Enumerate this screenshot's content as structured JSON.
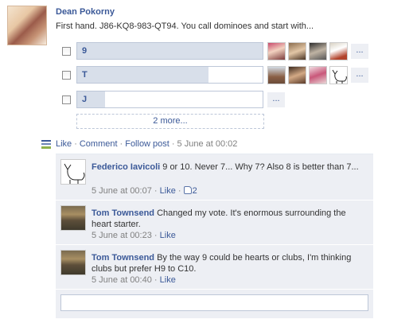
{
  "post": {
    "author": "Dean Pokorny",
    "text": "First hand. J86-KQ8-983-QT94. You call dominoes and start with..."
  },
  "poll": {
    "options": [
      {
        "label": "9",
        "fraction": 1.0,
        "more": "..."
      },
      {
        "label": "T",
        "fraction": 0.71,
        "more": "..."
      },
      {
        "label": "J",
        "fraction": 0.15,
        "more": "..."
      }
    ],
    "more_options": "2 more..."
  },
  "actions": {
    "like": "Like",
    "comment": "Comment",
    "follow": "Follow post",
    "time": "5 June at 00:02"
  },
  "comments": [
    {
      "author": "Federico Iavicoli",
      "text": "9 or 10. Never 7... Why 7? Also 8 is better than 7...",
      "time": "5 June at 00:07",
      "like": "Like",
      "likes_count": "2"
    },
    {
      "author": "Tom Townsend",
      "text": "Changed my vote. It's enormous surrounding the heart starter.",
      "time": "5 June at 00:23",
      "like": "Like"
    },
    {
      "author": "Tom Townsend",
      "text": "By the way 9 could be hearts or clubs, I'm thinking clubs but prefer H9 to C10.",
      "time": "5 June at 00:40",
      "like": "Like"
    }
  ],
  "reply": {
    "placeholder": ""
  },
  "colors": {
    "link": "#3b5998",
    "bar_fill": "#d8dfea",
    "comment_bg": "#edeff4"
  }
}
